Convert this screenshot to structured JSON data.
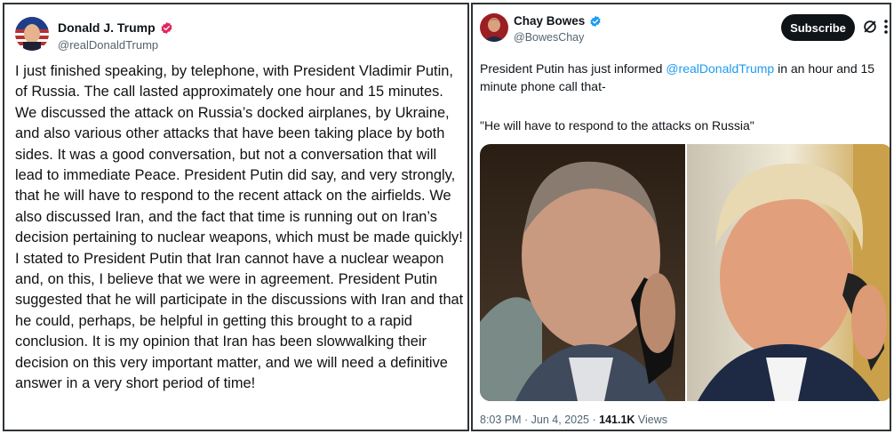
{
  "left_post": {
    "display_name": "Donald J. Trump",
    "handle": "@realDonaldTrump",
    "body": "I just finished speaking, by telephone, with President Vladimir Putin, of Russia. The call lasted approximately one hour and 15 minutes. We discussed the attack on Russia’s docked airplanes, by Ukraine, and also various other attacks that have been taking place by both sides. It was a good conversation, but not a conversation that will lead to immediate Peace. President Putin did say, and very strongly, that he will have to respond to the recent attack on the airfields. We also discussed Iran, and the fact that time is running out on Iran’s decision pertaining to nuclear weapons, which must be made quickly! I stated to President Putin that Iran cannot have a nuclear weapon and, on this, I believe that we were in agreement. President Putin suggested that he will participate in the discussions with Iran and that he could, perhaps, be helpful in getting this brought to a rapid conclusion. It is my opinion that Iran has been slowwalking their decision on this very important matter, and we will need a definitive answer in a very short period of time!"
  },
  "right_post": {
    "display_name": "Chay Bowes",
    "handle": "@BowesChay",
    "subscribe_label": "Subscribe",
    "text_before_mention": "President Putin has just informed ",
    "mention": "@realDonaldTrump",
    "text_after_mention": " in an hour and 15 minute phone call that-",
    "quote": "\"He will have to respond to the attacks on Russia\"",
    "time": "8:03 PM",
    "separator": " · ",
    "date": "Jun 4, 2025",
    "views_count": "141.1K",
    "views_label": " Views"
  },
  "icons": {
    "verified": "verified-badge-icon",
    "grok": "grok-icon",
    "more": "more-options-icon"
  },
  "colors": {
    "link": "#1d9bf0",
    "verified_left": "#e0245e",
    "verified_right": "#1d9bf0",
    "button": "#0f1419"
  }
}
